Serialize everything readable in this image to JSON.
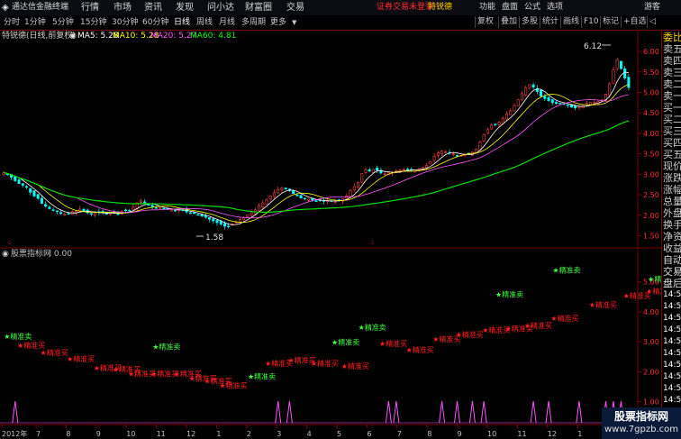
{
  "menubar": {
    "app_title": "通达信金融终端",
    "items": [
      "行情",
      "市场",
      "资讯",
      "发现",
      "问小达",
      "财富圈",
      "交易"
    ],
    "status": "证券交易未登录",
    "stock": "特锐德",
    "right_items": [
      "功能",
      "盘面",
      "公式",
      "选项"
    ],
    "guest": "游客"
  },
  "toolbar": {
    "periods": [
      "分时",
      "1分钟",
      "5分钟",
      "15分钟",
      "30分钟",
      "60分钟",
      "日线",
      "周线",
      "月线",
      "多周期",
      "更多"
    ],
    "active": "日线",
    "right_buttons": [
      "复权",
      "叠加",
      "多股",
      "统计",
      "画线",
      "F10",
      "标记",
      "+自选"
    ],
    "back_label": "◁"
  },
  "info": {
    "title": "特锐德(日线,前复权)",
    "ma5": "MA5: 5.28",
    "ma10": "MA10: 5.28",
    "ma20": "MA20: 5.27",
    "ma60": "MA60: 4.81"
  },
  "main_axis": {
    "labels": [
      "6.00",
      "5.50",
      "5.00",
      "4.50",
      "4.00",
      "3.50",
      "3.00",
      "2.50",
      "2.00",
      "1.50"
    ],
    "ymin": 1.4,
    "ymax": 6.2
  },
  "annotations": {
    "high": "6.12",
    "low": "1.58"
  },
  "indicator": {
    "title": "股票指标网",
    "value": ": 0.00",
    "axis_labels": [
      "5.00",
      "4.00",
      "3.00",
      "2.00",
      "1.00"
    ],
    "buy_label": "★精准买",
    "sell_label": "★精准卖",
    "sell_signals": [
      [
        1,
        3.1
      ],
      [
        40,
        2.75
      ],
      [
        65,
        1.75
      ],
      [
        87,
        2.9
      ],
      [
        94,
        3.4
      ],
      [
        130,
        4.5
      ],
      [
        145,
        5.3
      ],
      [
        170,
        5.0
      ]
    ],
    "buy_signals": [
      [
        5,
        2.8
      ],
      [
        11,
        2.55
      ],
      [
        18,
        2.35
      ],
      [
        25,
        2.05
      ],
      [
        30,
        2.0
      ],
      [
        34,
        1.85
      ],
      [
        40,
        1.85
      ],
      [
        46,
        1.85
      ],
      [
        50,
        1.7
      ],
      [
        54,
        1.6
      ],
      [
        58,
        1.45
      ],
      [
        70,
        2.2
      ],
      [
        76,
        2.3
      ],
      [
        82,
        2.2
      ],
      [
        90,
        2.1
      ],
      [
        100,
        2.85
      ],
      [
        107,
        2.65
      ],
      [
        114,
        3.0
      ],
      [
        120,
        3.15
      ],
      [
        127,
        3.3
      ],
      [
        133,
        3.35
      ],
      [
        138,
        3.45
      ],
      [
        145,
        3.7
      ],
      [
        155,
        4.15
      ],
      [
        164,
        4.45
      ],
      [
        170,
        4.6
      ],
      [
        182,
        5.1
      ]
    ],
    "spikes": [
      3,
      72,
      75,
      101,
      103,
      115,
      119,
      123,
      126,
      139,
      143,
      151,
      158,
      160,
      162
    ]
  },
  "x_axis": {
    "labels": [
      "2012年",
      "7",
      "8",
      "9",
      "10",
      "11",
      "12",
      "1",
      "2",
      "3",
      "4",
      "5",
      "6",
      "7",
      "8",
      "9",
      "10",
      "11",
      "12",
      "1",
      "2"
    ]
  },
  "watermark": {
    "line1": "股票指标网",
    "line2": "www.7gpzb.com"
  },
  "right_panel": {
    "top_label": "委比",
    "labels": [
      "卖五",
      "卖四",
      "卖三",
      "卖二",
      "卖一",
      "买一",
      "买二",
      "买三",
      "买四",
      "买五",
      "现价",
      "涨跌",
      "涨幅",
      "总量",
      "外盘",
      "换手",
      "净资",
      "收益",
      "自动",
      "交易",
      "盘后",
      "14:5",
      "14:5",
      "14:5",
      "14:5",
      "14:5",
      "14:5",
      "14:5",
      "14:5",
      "14:5",
      "14:5",
      "14:5",
      "14:5"
    ]
  },
  "chart_data": {
    "type": "candlestick",
    "ylim": [
      1.4,
      6.2
    ],
    "close": [
      3.04,
      3.0,
      2.93,
      2.84,
      2.77,
      2.73,
      2.68,
      2.56,
      2.47,
      2.41,
      2.29,
      2.22,
      2.16,
      2.12,
      2.09,
      2.04,
      2.02,
      2.04,
      2.09,
      2.09,
      2.15,
      2.1,
      2.06,
      2.04,
      2.06,
      2.07,
      2.06,
      2.03,
      2.06,
      2.05,
      2.02,
      2.09,
      2.11,
      2.11,
      2.2,
      2.3,
      2.35,
      2.3,
      2.24,
      2.21,
      2.18,
      2.18,
      2.15,
      2.14,
      2.13,
      2.12,
      2.13,
      2.12,
      2.08,
      2.04,
      2.04,
      2.0,
      1.98,
      1.95,
      1.9,
      1.86,
      1.82,
      1.78,
      1.73,
      1.73,
      1.78,
      1.84,
      1.89,
      1.94,
      2.01,
      2.06,
      2.13,
      2.24,
      2.3,
      2.38,
      2.47,
      2.55,
      2.63,
      2.66,
      2.64,
      2.6,
      2.53,
      2.48,
      2.42,
      2.4,
      2.39,
      2.37,
      2.35,
      2.35,
      2.34,
      2.36,
      2.34,
      2.34,
      2.36,
      2.4,
      2.47,
      2.6,
      2.7,
      2.8,
      3.02,
      3.11,
      3.08,
      3.12,
      3.1,
      3.03,
      3.01,
      3.04,
      3.05,
      3.08,
      3.1,
      3.12,
      3.11,
      3.1,
      3.11,
      3.14,
      3.17,
      3.22,
      3.31,
      3.44,
      3.53,
      3.57,
      3.55,
      3.52,
      3.5,
      3.46,
      3.46,
      3.48,
      3.5,
      3.54,
      3.62,
      3.79,
      3.97,
      4.09,
      4.2,
      4.22,
      4.27,
      4.37,
      4.48,
      4.55,
      4.68,
      4.82,
      4.97,
      5.12,
      5.19,
      5.13,
      5.02,
      4.91,
      4.85,
      4.8,
      4.75,
      4.73,
      4.74,
      4.72,
      4.69,
      4.64,
      4.62,
      4.65,
      4.68,
      4.73,
      4.76,
      4.76,
      4.78,
      4.82,
      4.96,
      5.21,
      5.55,
      5.8,
      5.58,
      5.35,
      5.12
    ]
  }
}
